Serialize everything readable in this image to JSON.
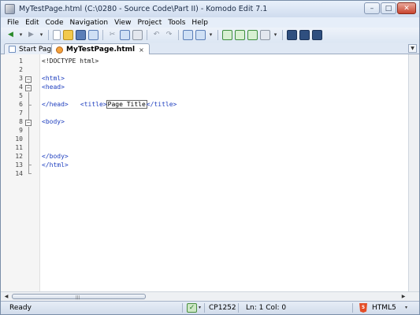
{
  "window": {
    "title": "MyTestPage.html (C:\\0280 - Source Code\\Part II) - Komodo Edit 7.1",
    "minimize": "–",
    "maximize": "□",
    "close": "✕"
  },
  "menu": [
    "File",
    "Edit",
    "Code",
    "Navigation",
    "View",
    "Project",
    "Tools",
    "Help"
  ],
  "tabs": [
    {
      "label": "Start Page",
      "icon": "start-page-icon",
      "active": false
    },
    {
      "label": "MyTestPage.html",
      "icon": "html-file-icon",
      "active": true,
      "close": "×"
    }
  ],
  "editor": {
    "line_numbers": [
      "1",
      "2",
      "3",
      "4",
      "5",
      "6",
      "7",
      "8",
      "9",
      "10",
      "11",
      "12",
      "13",
      "14"
    ],
    "lines": {
      "l1": "<!DOCTYPE html>",
      "l3": "<html>",
      "l4": "<head>",
      "l5_open": "<title>",
      "l5_text": "Page Title",
      "l5_close": "</title>",
      "l6": "</head>",
      "l8": "<body>",
      "l12": "</body>",
      "l13": "</html>"
    },
    "fold_minus": "−"
  },
  "status": {
    "ready": "Ready",
    "encoding": "CP1252",
    "position": "Ln: 1 Col: 0",
    "language": "HTML5"
  },
  "colors": {
    "tag": "#1f3fbf",
    "window_frame": "#dce7f4",
    "html5_badge": "#e44d26"
  }
}
